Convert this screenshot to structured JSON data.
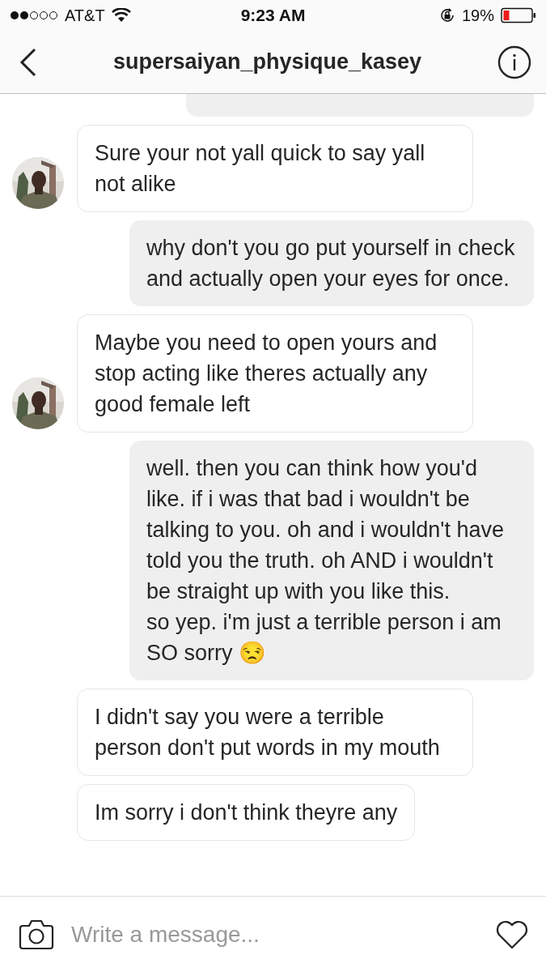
{
  "status_bar": {
    "carrier": "AT&T",
    "time": "9:23 AM",
    "battery": "19%"
  },
  "header": {
    "title": "supersaiyan_physique_kasey"
  },
  "messages": [
    {
      "kind": "outgoing"
    },
    {
      "kind": "incoming",
      "avatar": true,
      "text": "Sure your not yall quick to say yall not alike"
    },
    {
      "kind": "outgoing",
      "text": "why don't you go put yourself in check and actually open your eyes for once."
    },
    {
      "kind": "incoming",
      "avatar": true,
      "text": "Maybe you need to open yours and stop acting like theres actually any good female left"
    },
    {
      "kind": "outgoing",
      "text": "well. then you can think how you'd like. if i was that bad i wouldn't be talking to you. oh and i wouldn't have told you the truth. oh AND i wouldn't be straight up with you like this.\nso yep. i'm just a terrible person i am SO sorry 😒"
    },
    {
      "kind": "incoming",
      "avatar": false,
      "text": "I didn't say you were a terrible person don't put words in my mouth"
    },
    {
      "kind": "incoming",
      "avatar": false,
      "text": "Im sorry i don't think theyre any"
    }
  ],
  "composer": {
    "placeholder": "Write a message..."
  }
}
